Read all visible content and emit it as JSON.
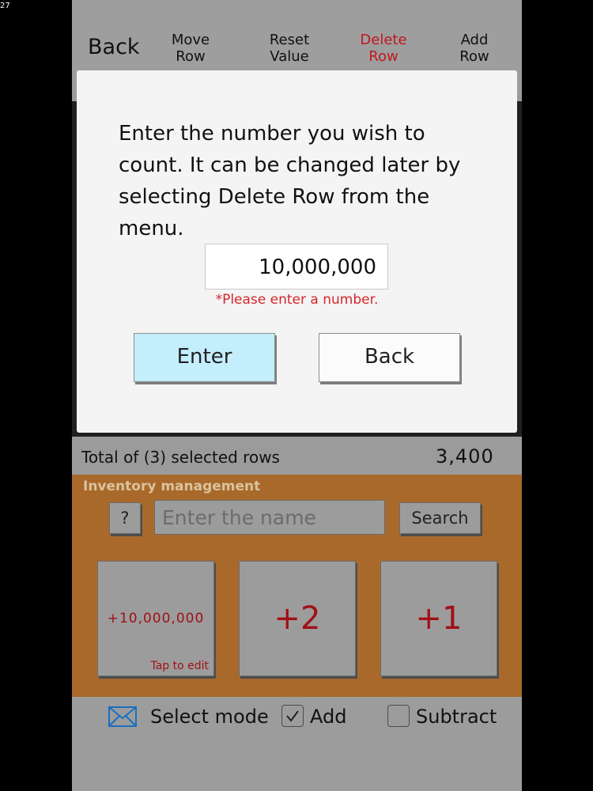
{
  "statusbar": {
    "time": "27"
  },
  "menu": {
    "back": "Back",
    "move_row": [
      "Move",
      "Row"
    ],
    "reset_value": [
      "Reset",
      "Value"
    ],
    "delete_row": [
      "Delete",
      "Row"
    ],
    "add_row": [
      "Add",
      "Row"
    ],
    "delete_color": "#c0181c"
  },
  "total": {
    "label": "Total of (3) selected rows",
    "value": "3,400"
  },
  "inventory": {
    "title": "Inventory management",
    "help_label": "?",
    "search_placeholder": "Enter the name",
    "search_button": "Search",
    "counters": [
      {
        "label": "+10,000,000",
        "hint": "Tap to edit"
      },
      {
        "label": "+2"
      },
      {
        "label": "+1"
      }
    ],
    "bg_color": "#a9692a"
  },
  "bottom": {
    "icon": "mail-icon",
    "select_mode": "Select mode",
    "add_label": "Add",
    "add_checked": true,
    "subtract_label": "Subtract",
    "subtract_checked": false
  },
  "dialog": {
    "message": "Enter the number you wish to count. It can be changed later by selecting Delete Row from the menu.",
    "input_value": "10,000,000",
    "error": "*Please enter a number.",
    "enter_button": "Enter",
    "back_button": "Back",
    "enter_color": "#c4eefc"
  }
}
